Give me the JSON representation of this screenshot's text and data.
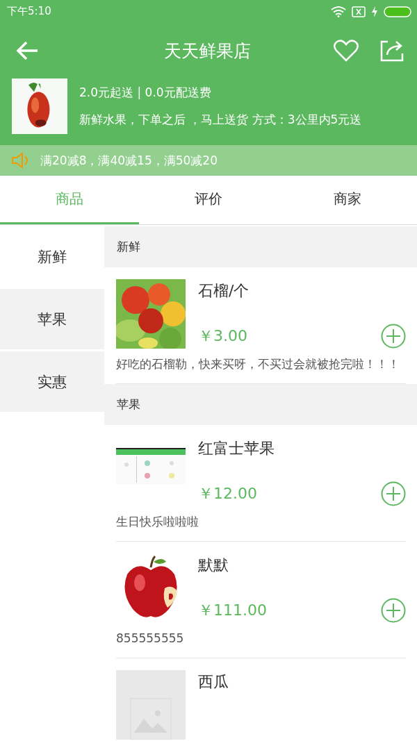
{
  "status_bar": {
    "time": "下午5:10"
  },
  "header": {
    "title": "天天鲜果店"
  },
  "shop": {
    "delivery": "2.0元起送 | 0.0元配送费",
    "description": "新鲜水果，下单之后 ，马上送货 方式：3公里内5元送"
  },
  "notice": {
    "text": "满20减8，满40减15，满50减20"
  },
  "tabs": [
    {
      "label": "商品",
      "selected": true
    },
    {
      "label": "评价",
      "selected": false
    },
    {
      "label": "商家",
      "selected": false
    }
  ],
  "categories": [
    {
      "label": "新鲜",
      "selected": true
    },
    {
      "label": "苹果",
      "selected": false
    },
    {
      "label": "实惠",
      "selected": false
    }
  ],
  "sections": [
    {
      "title": "新鲜",
      "products": [
        {
          "name": "石榴/个",
          "price": "￥3.00",
          "description": "好吃的石榴勒，快来买呀，不买过会就被抢完啦！！！"
        }
      ]
    },
    {
      "title": "苹果",
      "products": [
        {
          "name": "红富士苹果",
          "price": "￥12.00",
          "description": "生日快乐啦啦啦"
        },
        {
          "name": "默默",
          "price": "￥111.00",
          "description": "855555555"
        },
        {
          "image": {
            "kind": "placeholder"
          },
          "name": "西瓜"
        }
      ]
    }
  ]
}
